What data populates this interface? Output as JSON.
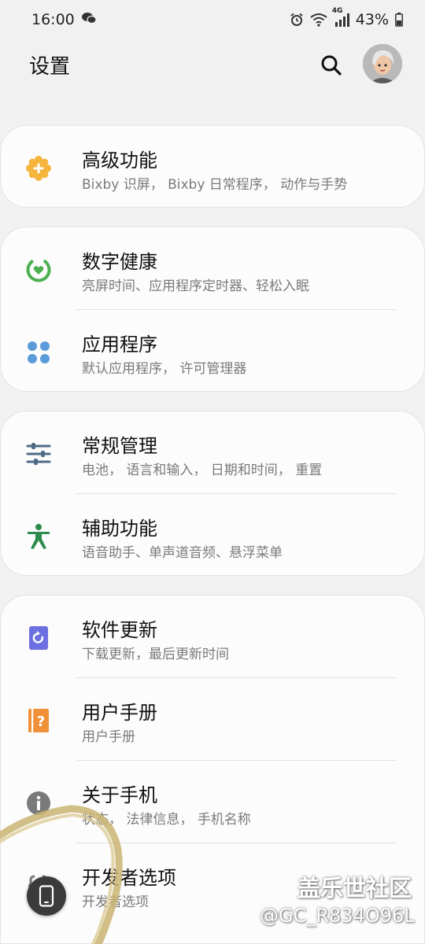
{
  "status_bar": {
    "time": "16:00",
    "battery": "43%",
    "network": "4G"
  },
  "header": {
    "title": "设置"
  },
  "cards": [
    {
      "items": [
        {
          "name": "advanced-features",
          "title": "高级功能",
          "subtitle": "Bixby 识屏， Bixby 日常程序， 动作与手势",
          "icon": "advanced-features-icon",
          "color": "#f5b43c"
        }
      ]
    },
    {
      "items": [
        {
          "name": "digital-wellbeing",
          "title": "数字健康",
          "subtitle": "亮屏时间、应用程序定时器、轻松入眠",
          "icon": "digital-wellbeing-icon",
          "color": "#4caf50"
        },
        {
          "name": "apps",
          "title": "应用程序",
          "subtitle": "默认应用程序， 许可管理器",
          "icon": "apps-icon",
          "color": "#5b9bd9"
        }
      ]
    },
    {
      "items": [
        {
          "name": "general-management",
          "title": "常规管理",
          "subtitle": "电池， 语言和输入， 日期和时间， 重置",
          "icon": "sliders-icon",
          "color": "#4f6a86"
        },
        {
          "name": "accessibility",
          "title": "辅助功能",
          "subtitle": "语音助手、单声道音频、悬浮菜单",
          "icon": "accessibility-icon",
          "color": "#2e8b4e"
        }
      ]
    },
    {
      "items": [
        {
          "name": "software-update",
          "title": "软件更新",
          "subtitle": "下载更新，最后更新时间",
          "icon": "software-update-icon",
          "color": "#6b6fe0"
        },
        {
          "name": "user-manual",
          "title": "用户手册",
          "subtitle": "用户手册",
          "icon": "user-manual-icon",
          "color": "#f0913a"
        },
        {
          "name": "about-phone",
          "title": "关于手机",
          "subtitle": "状态， 法律信息， 手机名称",
          "icon": "info-icon",
          "color": "#7a7a7a"
        },
        {
          "name": "developer-options",
          "title": "开发者选项",
          "subtitle": "开发者选项",
          "icon": "developer-icon",
          "color": "#7a7a7a"
        }
      ]
    }
  ],
  "watermark": {
    "line1": "盖乐世社区",
    "line2": "@GC_R834O96L"
  }
}
